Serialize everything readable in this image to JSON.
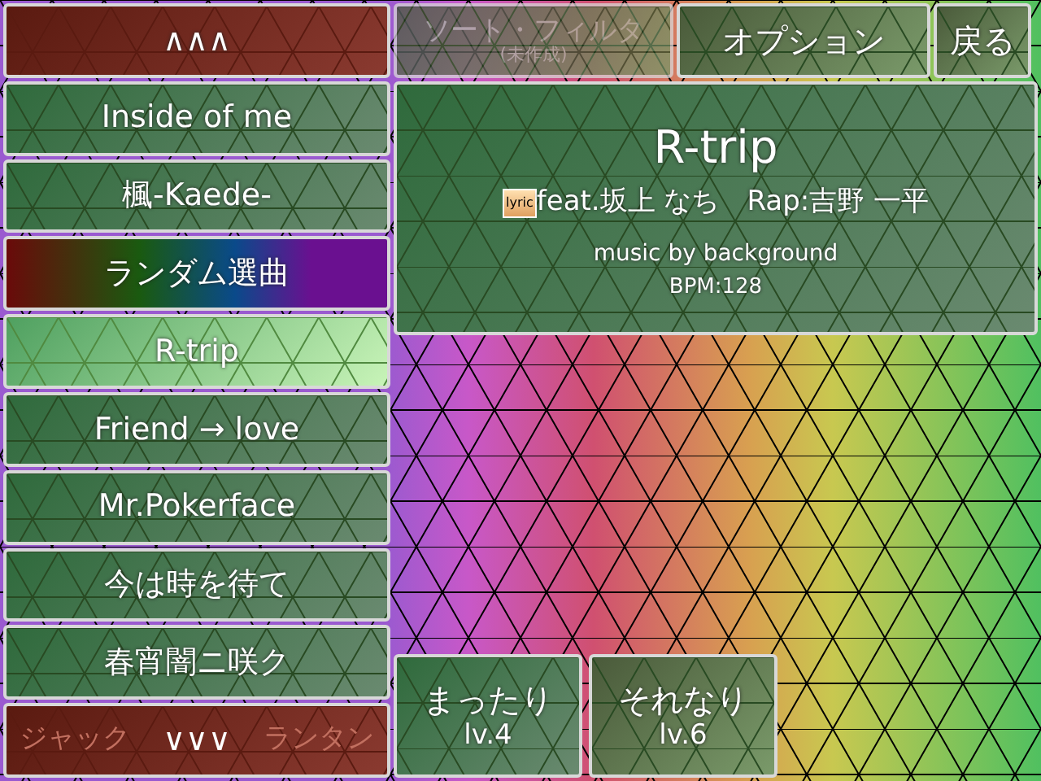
{
  "nav_up": {
    "label": "∧∧∧"
  },
  "song_list": [
    {
      "title": "Inside of me",
      "kind": "song",
      "selected": false
    },
    {
      "title": "楓-Kaede-",
      "kind": "song",
      "selected": false
    },
    {
      "title": "ランダム選曲",
      "kind": "random",
      "selected": false
    },
    {
      "title": "R-trip",
      "kind": "song",
      "selected": true
    },
    {
      "title": "Friend → love",
      "kind": "song",
      "selected": false
    },
    {
      "title": "Mr.Pokerface",
      "kind": "song",
      "selected": false
    },
    {
      "title": "今は時を待て",
      "kind": "song",
      "selected": false
    },
    {
      "title": "春宵闇ニ咲ク",
      "kind": "song",
      "selected": false
    }
  ],
  "nav_down": {
    "label": "∨∨∨",
    "peek_left": "ジャック",
    "peek_right": "ランタン"
  },
  "toolbar": [
    {
      "label": "ソート・フィルタ",
      "sublabel": "(未作成)",
      "disabled": true
    },
    {
      "label": "オプション",
      "disabled": false
    },
    {
      "label": "戻る",
      "disabled": false
    }
  ],
  "song_info": {
    "title": "R-trip",
    "lyric_badge": "lyric",
    "credit": "feat.坂上 なち　Rap:吉野 一平",
    "music": "music by background",
    "bpm": "BPM:128"
  },
  "difficulties": [
    {
      "name": "まったり",
      "level_label": "lv.4"
    },
    {
      "name": "それなり",
      "level_label": "lv.6"
    }
  ]
}
